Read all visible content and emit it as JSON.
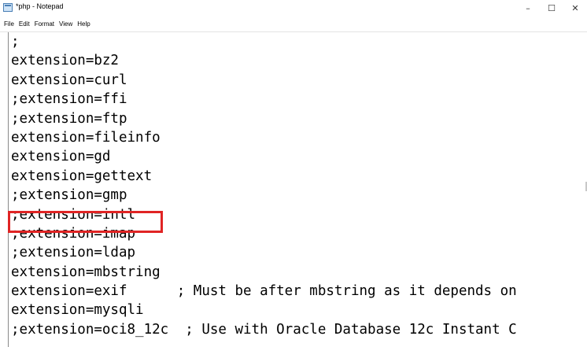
{
  "window": {
    "title": "*php - Notepad",
    "controls": {
      "minimize": "–",
      "maximize": "☐",
      "close": "✕"
    }
  },
  "menu": {
    "items": [
      "File",
      "Edit",
      "Format",
      "View",
      "Help"
    ]
  },
  "editor": {
    "lines": [
      ";",
      "extension=bz2",
      "extension=curl",
      ";extension=ffi",
      ";extension=ftp",
      "extension=fileinfo",
      "extension=gd",
      "extension=gettext",
      ";extension=gmp",
      ";extension=intl",
      ";extension=imap",
      ";extension=ldap",
      "extension=mbstring",
      "extension=exif      ; Must be after mbstring as it depends on",
      "extension=mysqli",
      ";extension=oci8_12c  ; Use with Oracle Database 12c Instant C"
    ],
    "highlighted_line_index": 9,
    "highlight_color": "#e02424"
  }
}
